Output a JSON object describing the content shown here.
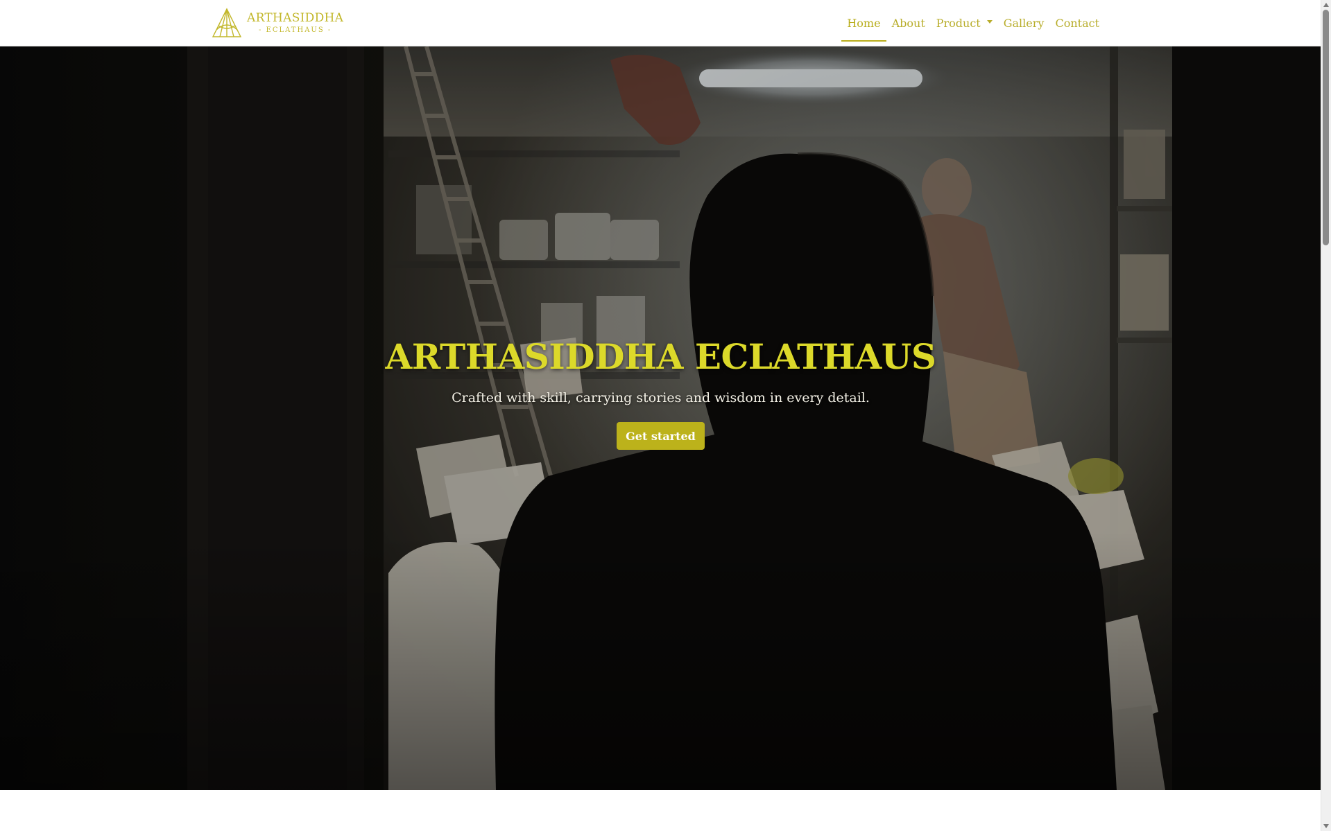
{
  "brand": {
    "title": "ARTHASIDDHA",
    "subtitle": "- ECLATHAUS -",
    "logo_icon": "pyramid-logo-icon",
    "color": "#c2b72a"
  },
  "nav": {
    "items": [
      {
        "label": "Home",
        "active": true
      },
      {
        "label": "About",
        "active": false
      },
      {
        "label": "Product",
        "active": false,
        "dropdown": true
      },
      {
        "label": "Gallery",
        "active": false
      },
      {
        "label": "Contact",
        "active": false
      }
    ],
    "dropdown_icon": "chevron-down-icon"
  },
  "hero": {
    "title": "ARTHASIDDHA ECLATHAUS",
    "subtitle": "Crafted with skill, carrying stories and wisdom in every detail.",
    "cta_label": "Get started"
  },
  "colors": {
    "accent": "#bcb21b",
    "title": "#dcd92a",
    "hero_bg": "#0d0c0b"
  }
}
